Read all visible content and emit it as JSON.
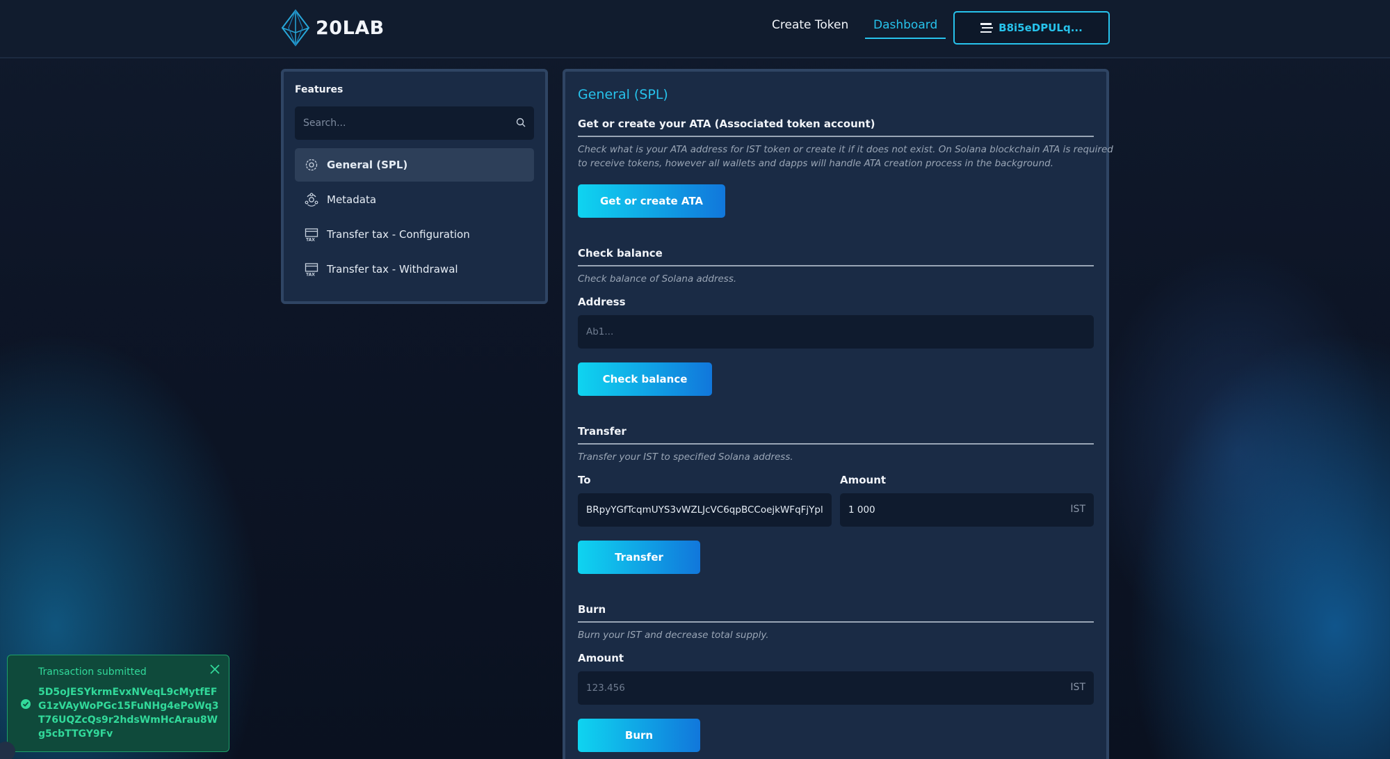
{
  "header": {
    "logo_text": "20LAB",
    "nav": {
      "create_token": "Create Token",
      "dashboard": "Dashboard"
    },
    "wallet_label": "B8i5eDPULq..."
  },
  "sidebar": {
    "title": "Features",
    "search_placeholder": "Search...",
    "items": [
      {
        "label": "General (SPL)",
        "icon": "gear-brain-icon",
        "active": true
      },
      {
        "label": "Metadata",
        "icon": "network-gear-icon",
        "active": false
      },
      {
        "label": "Transfer tax - Configuration",
        "icon": "tax-card-icon",
        "active": false
      },
      {
        "label": "Transfer tax - Withdrawal",
        "icon": "tax-card-icon",
        "active": false
      }
    ]
  },
  "main": {
    "title": "General (SPL)",
    "ata": {
      "heading": "Get or create your ATA (Associated token account)",
      "description": "Check what is your ATA address for IST token or create it if it does not exist. On Solana blockchain ATA is required to receive tokens, however all wallets and dapps will handle ATA creation process in the background.",
      "button": "Get or create ATA"
    },
    "balance": {
      "heading": "Check balance",
      "description": "Check balance of Solana address.",
      "address_label": "Address",
      "address_placeholder": "Ab1...",
      "button": "Check balance"
    },
    "transfer": {
      "heading": "Transfer",
      "description": "Transfer your IST to specified Solana address.",
      "to_label": "To",
      "to_value": "BRpyYGfTcqmUYS3vWZLJcVC6qpBCCoejkWFqFjYpl",
      "amount_label": "Amount",
      "amount_value": "1 000",
      "amount_suffix": "IST",
      "button": "Transfer"
    },
    "burn": {
      "heading": "Burn",
      "description": "Burn your IST and decrease total supply.",
      "amount_label": "Amount",
      "amount_placeholder": "123.456",
      "amount_suffix": "IST",
      "button": "Burn"
    }
  },
  "toast": {
    "title": "Transaction submitted",
    "signature": "5D5oJESYkrmEvxNVeqL9cMytfEFG1zVAyWoPGc15FuNHg4ePoWq3T76UQZcQs9r2hdsWmHcArau8Wg5cbTTGY9Fv"
  },
  "colors": {
    "accent": "#27c3ec",
    "panel": "#1a2b45",
    "success": "#32d99a"
  }
}
